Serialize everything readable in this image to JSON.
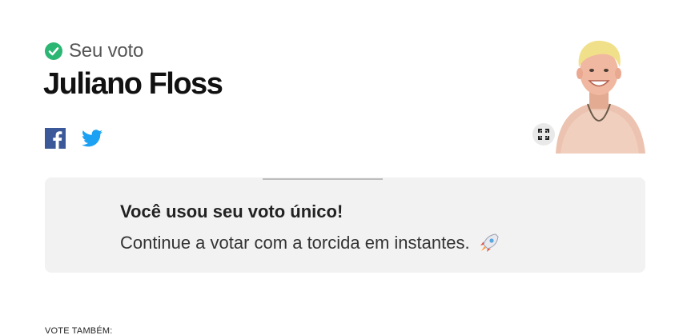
{
  "vote": {
    "label": "Seu voto",
    "candidate": "Juliano Floss"
  },
  "share": {
    "facebook_icon": "facebook-icon",
    "twitter_icon": "twitter-icon"
  },
  "photo": {
    "expand_icon": "expand-icon"
  },
  "notice": {
    "title": "Você usou seu voto único!",
    "body": "Continue a votar com a torcida em instantes.",
    "emoji_icon": "rocket-icon"
  },
  "footer": {
    "vote_also": "VOTE TAMBÉM:"
  },
  "colors": {
    "check_green": "#2bb673",
    "facebook_blue": "#3b5998",
    "twitter_blue": "#1da1f2",
    "notice_bg": "#f2f2f2"
  }
}
